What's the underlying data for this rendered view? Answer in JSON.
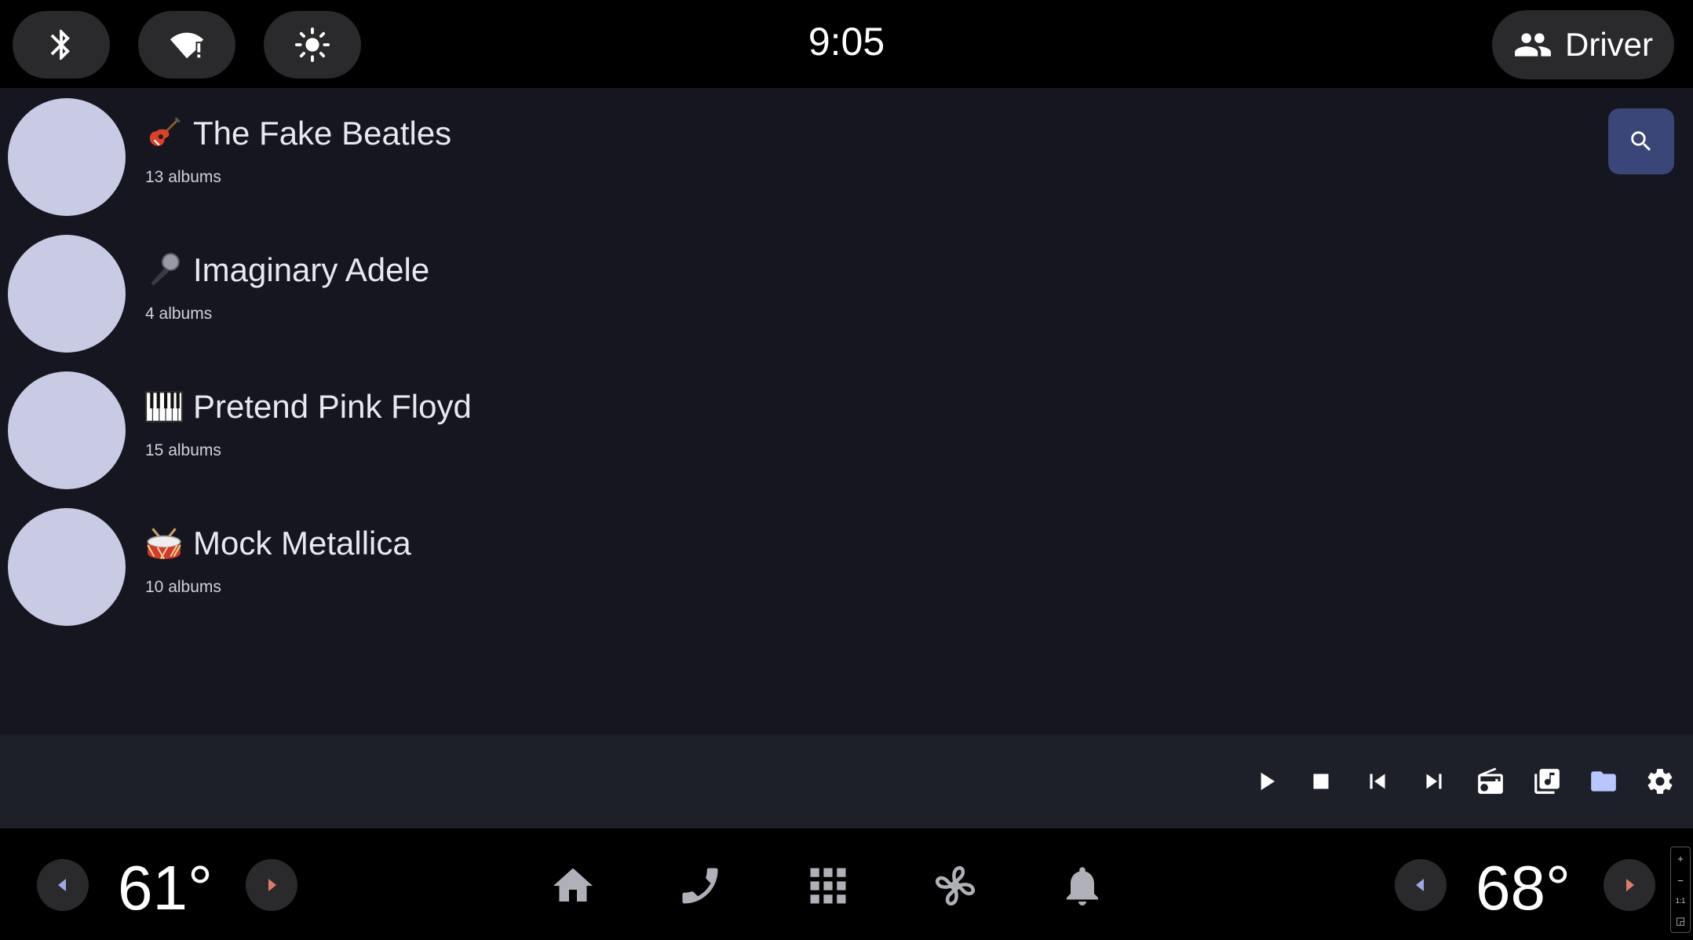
{
  "status_bar": {
    "time": "9:05",
    "profile_label": "Driver",
    "icons": [
      "bluetooth-icon",
      "wifi-alert-icon",
      "brightness-icon",
      "people-icon"
    ]
  },
  "artists": [
    {
      "name": "The Fake Beatles",
      "albums": "13 albums",
      "emoji_icon": "guitar-icon"
    },
    {
      "name": "Imaginary Adele",
      "albums": "4 albums",
      "emoji_icon": "microphone-icon"
    },
    {
      "name": "Pretend Pink Floyd",
      "albums": "15 albums",
      "emoji_icon": "piano-keys-icon"
    },
    {
      "name": "Mock Metallica",
      "albums": "10 albums",
      "emoji_icon": "drum-icon"
    }
  ],
  "media_controls": [
    "play-icon",
    "stop-icon",
    "skip-previous-icon",
    "skip-next-icon",
    "radio-icon",
    "library-music-icon",
    "folder-icon",
    "settings-icon"
  ],
  "climate": {
    "left_temp": "61°",
    "right_temp": "68°"
  },
  "nav_icons": [
    "home-icon",
    "phone-icon",
    "app-grid-icon",
    "fan-icon",
    "notification-bell-icon"
  ],
  "zoom_controls": {
    "plus": "+",
    "minus": "−",
    "one_to_one": "1:1",
    "fit": "◲"
  },
  "colors": {
    "content_bg": "#15161f",
    "media_bar_bg": "#1e2029",
    "avatar": "#c8cbe3",
    "search_button": "#3a4578",
    "arrow_accent": "#e07a66",
    "arrow_left_accent": "#9aa8e6",
    "folder_accent": "#b8c6ff"
  }
}
